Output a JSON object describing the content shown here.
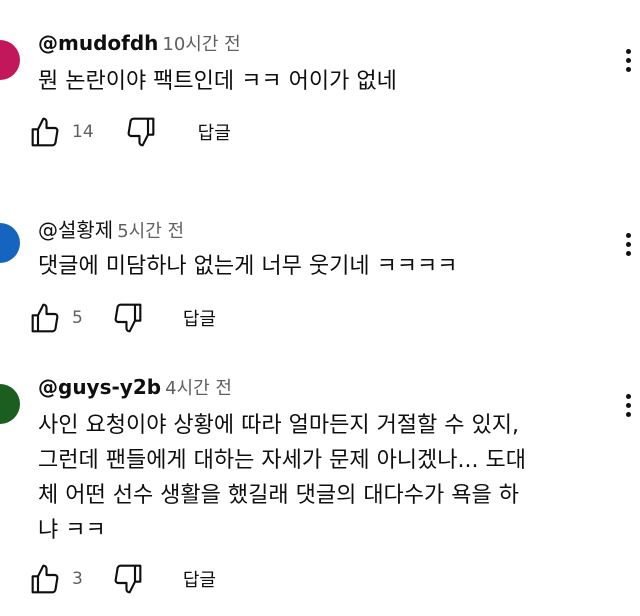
{
  "comments": [
    {
      "author": "@mudofdh",
      "time": "10시간 전",
      "lines": [
        "뭔 논란이야 팩트인데 ㅋㅋ 어이가 없네"
      ],
      "likes": "14",
      "reply_label": "답글",
      "avatar_color": "#c2185b"
    },
    {
      "author": "@설황제",
      "time": "5시간 전",
      "lines": [
        "댓글에 미담하나 없는게 너무 웃기네 ㅋㅋㅋㅋ"
      ],
      "likes": "5",
      "reply_label": "답글",
      "avatar_color": "#1565c0"
    },
    {
      "author": "@guys-y2b",
      "time": "4시간 전",
      "lines": [
        "사인 요청이야 상황에 따라 얼마든지 거절할 수 있지,",
        "그런데 팬들에게 대하는 자세가 문제 아니겠나... 도대",
        "체 어떤 선수 생활을 했길래 댓글의 대다수가 욕을 하",
        "냐 ㅋㅋ"
      ],
      "likes": "3",
      "reply_label": "답글",
      "avatar_color": "#1b5e20"
    }
  ],
  "icons": {
    "like": "thumb-up-icon",
    "dislike": "thumb-down-icon",
    "more": "more-vert-icon"
  }
}
